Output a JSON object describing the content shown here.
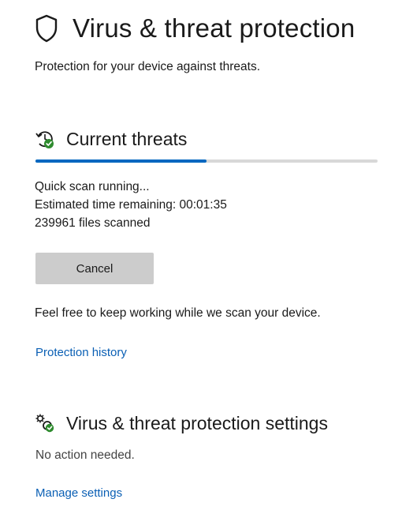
{
  "page": {
    "title": "Virus & threat protection",
    "subtitle": "Protection for your device against threats.",
    "title_icon": "shield-icon"
  },
  "current_threats": {
    "title": "Current threats",
    "icon": "scan-refresh-icon",
    "scan_progress_fraction": 0.5,
    "status": "Quick scan running...",
    "time_remaining": "Estimated time remaining: 00:01:35",
    "files_scanned": "239961 files scanned",
    "cancel_label": "Cancel",
    "info": "Feel free to keep working while we scan your device.",
    "history_link": "Protection history"
  },
  "settings": {
    "title": "Virus & threat protection settings",
    "icon": "gear-check-icon",
    "status": "No action needed.",
    "manage_link": "Manage settings"
  },
  "colors": {
    "accent": "#0067c0",
    "link": "#0a5fb4",
    "button": "#cccccc",
    "status_ok": "#2e8b2e"
  }
}
